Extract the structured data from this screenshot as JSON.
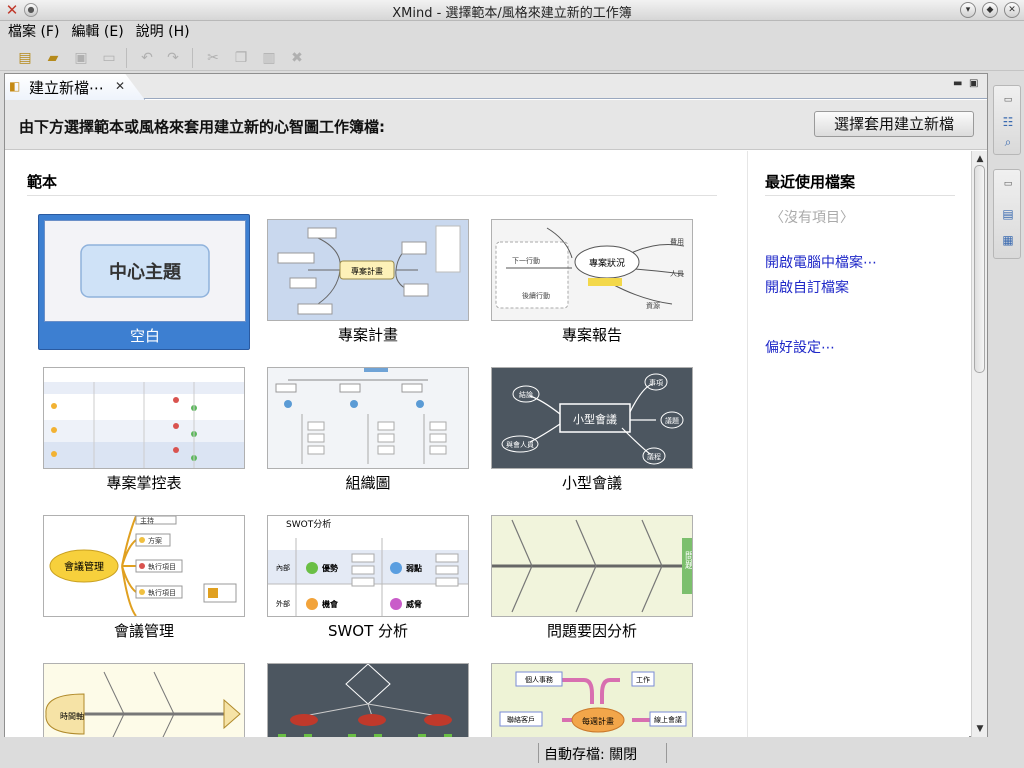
{
  "window": {
    "title": "XMind - 選擇範本/風格來建立新的工作簿"
  },
  "menu": [
    {
      "label": "檔案 (F)"
    },
    {
      "label": "編輯 (E)"
    },
    {
      "label": "說明 (H)"
    }
  ],
  "toolbar": {
    "icons": [
      "new-workbook-icon",
      "open-folder-icon",
      "save-icon",
      "print-icon",
      "undo-icon",
      "redo-icon",
      "cut-icon",
      "copy-icon",
      "paste-icon",
      "delete-icon"
    ]
  },
  "tab": {
    "label": "建立新檔⋯"
  },
  "header": {
    "description": "由下方選擇範本或風格來套用建立新的心智圖工作簿檔:",
    "create_button": "選擇套用建立新檔"
  },
  "templates": {
    "section_title": "範本",
    "items": [
      {
        "label": "空白",
        "selected": true,
        "thumb_text": "中心主題"
      },
      {
        "label": "專案計畫"
      },
      {
        "label": "專案報告"
      },
      {
        "label": "專案掌控表"
      },
      {
        "label": "組織圖"
      },
      {
        "label": "小型會議"
      },
      {
        "label": "會議管理"
      },
      {
        "label": "SWOT 分析"
      },
      {
        "label": "問題要因分析"
      },
      {
        "label": ""
      },
      {
        "label": ""
      },
      {
        "label": ""
      }
    ],
    "thumb_texts": {
      "project_plan_center": "專案計畫",
      "project_report_center": "專案狀況",
      "project_report_nodes": [
        "下一行動",
        "費用",
        "人員",
        "資源",
        "後續行動"
      ],
      "small_meeting_center": "小型會議",
      "small_meeting_nodes": [
        "結論",
        "事項",
        "議題",
        "議程",
        "與會人員"
      ],
      "meeting_center": "會議管理",
      "meeting_nodes": [
        "主持",
        "方案",
        "執行項目",
        "執行項目"
      ],
      "swot_title": "SWOT分析",
      "swot_cells": [
        "優勢",
        "弱點",
        "機會",
        "威脅",
        "內部",
        "外部"
      ],
      "cause_effect_head": "問題",
      "timeline_head": "時間軸",
      "weekly_center": "每週計畫",
      "weekly_nodes": [
        "個人事務",
        "工作",
        "聯絡客戶",
        "線上會議"
      ]
    }
  },
  "recent": {
    "title": "最近使用檔案",
    "none": "〈沒有項目〉",
    "links": [
      "開啟電腦中檔案⋯",
      "開啟自訂檔案"
    ],
    "preferences": "偏好設定⋯"
  },
  "status": {
    "autosave": "自動存檔: 關閉"
  }
}
